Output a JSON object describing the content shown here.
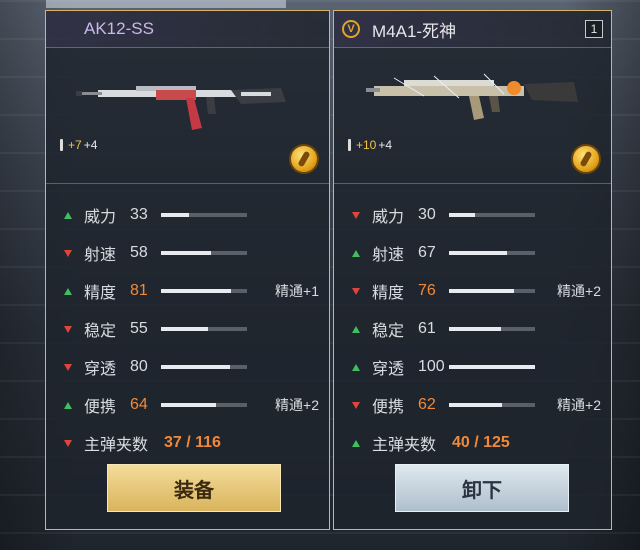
{
  "left": {
    "name": "AK12-SS",
    "ammo_bonus": "+7",
    "ammo_extra": "+4",
    "stats": [
      {
        "label": "威力",
        "value": "33",
        "dir": "up",
        "highlight": false,
        "fill": 0.33,
        "mastery": ""
      },
      {
        "label": "射速",
        "value": "58",
        "dir": "down",
        "highlight": false,
        "fill": 0.58,
        "mastery": ""
      },
      {
        "label": "精度",
        "value": "81",
        "dir": "up",
        "highlight": true,
        "fill": 0.81,
        "mastery": "精通+1"
      },
      {
        "label": "稳定",
        "value": "55",
        "dir": "down",
        "highlight": false,
        "fill": 0.55,
        "mastery": ""
      },
      {
        "label": "穿透",
        "value": "80",
        "dir": "down",
        "highlight": false,
        "fill": 0.8,
        "mastery": ""
      },
      {
        "label": "便携",
        "value": "64",
        "dir": "up",
        "highlight": true,
        "fill": 0.64,
        "mastery": "精通+2"
      }
    ],
    "magazine": {
      "label": "主弹夹数",
      "value": "37 / 116",
      "dir": "down"
    },
    "button": "装备"
  },
  "right": {
    "name": "M4A1-死神",
    "slot": "1",
    "ammo_bonus": "+10",
    "ammo_extra": "+4",
    "stats": [
      {
        "label": "威力",
        "value": "30",
        "dir": "down",
        "highlight": false,
        "fill": 0.3,
        "mastery": ""
      },
      {
        "label": "射速",
        "value": "67",
        "dir": "up",
        "highlight": false,
        "fill": 0.67,
        "mastery": ""
      },
      {
        "label": "精度",
        "value": "76",
        "dir": "down",
        "highlight": true,
        "fill": 0.76,
        "mastery": "精通+2"
      },
      {
        "label": "稳定",
        "value": "61",
        "dir": "up",
        "highlight": false,
        "fill": 0.61,
        "mastery": ""
      },
      {
        "label": "穿透",
        "value": "100",
        "dir": "up",
        "highlight": false,
        "fill": 1.0,
        "mastery": ""
      },
      {
        "label": "便携",
        "value": "62",
        "dir": "down",
        "highlight": true,
        "fill": 0.62,
        "mastery": "精通+2"
      }
    ],
    "magazine": {
      "label": "主弹夹数",
      "value": "40 / 125",
      "dir": "up"
    },
    "button": "卸下"
  },
  "icons": {
    "ammo": "bullet-icon",
    "coin": "gold-coin-icon",
    "badge": "legendary-v-icon"
  }
}
